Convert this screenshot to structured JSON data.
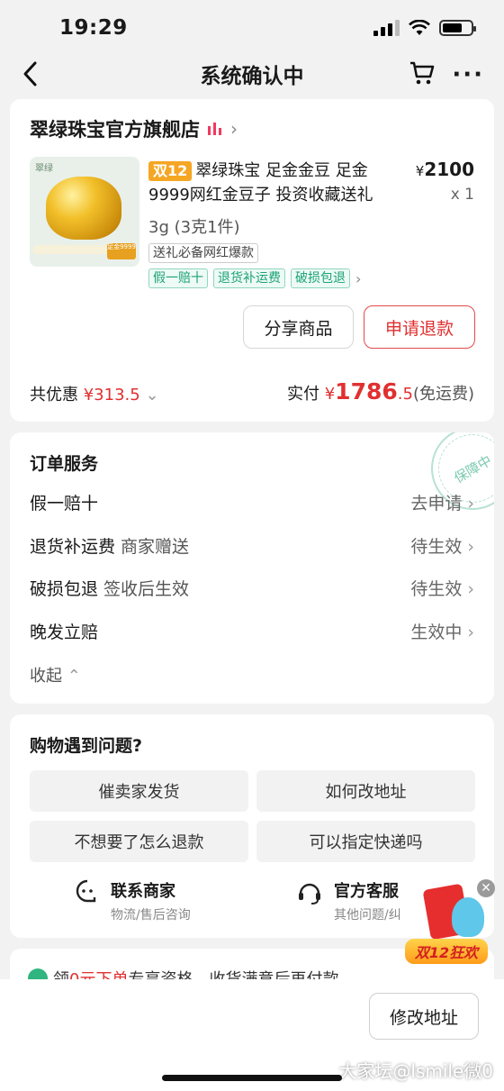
{
  "status_bar": {
    "time": "19:29"
  },
  "nav": {
    "title": "系统确认中"
  },
  "shop": {
    "name": "翠绿珠宝官方旗舰店",
    "thumb_logo": "翠绿",
    "thumb_tag": "足金9999",
    "product_badge": "双12",
    "product_title": "翠绿珠宝 足金金豆 足金9999网红金豆子 投资收藏送礼",
    "price_symbol": "¥",
    "price": "2100",
    "qty": "x 1",
    "spec": "3g (3克1件)",
    "tag_gift": "送礼必备网红爆款",
    "tags": [
      "假一赔十",
      "退货补运费",
      "破损包退"
    ],
    "share_button": "分享商品",
    "refund_button": "申请退款",
    "discount_label": "共优惠",
    "discount_value": "¥313.5",
    "paid_label": "实付",
    "paid_symbol": "¥",
    "paid_int": "1786",
    "paid_dec": ".5",
    "shipping_note": "(免运费)"
  },
  "service": {
    "title": "订单服务",
    "stamp": "保障中",
    "rows": [
      {
        "label": "假一赔十",
        "sub": "",
        "status": "去申请"
      },
      {
        "label": "退货补运费",
        "sub": "商家赠送",
        "status": "待生效"
      },
      {
        "label": "破损包退",
        "sub": "签收后生效",
        "status": "待生效"
      },
      {
        "label": "晚发立赔",
        "sub": "",
        "status": "生效中"
      }
    ],
    "collapse": "收起"
  },
  "help": {
    "title": "购物遇到问题?",
    "questions": [
      "催卖家发货",
      "如何改地址",
      "不想要了怎么退款",
      "可以指定快递吗"
    ],
    "contact_merchant": {
      "title": "联系商家",
      "sub": "物流/售后咨询"
    },
    "contact_official": {
      "title": "官方客服",
      "sub": "其他问题/纠"
    }
  },
  "promo": {
    "prefix": "领",
    "highlight": "0元下单",
    "suffix": "专享资格，收货满意后再付款"
  },
  "float_badge": {
    "label": "双12狂欢"
  },
  "bottom": {
    "address_button": "修改地址"
  },
  "watermark": "大家坛@lsmile微0"
}
